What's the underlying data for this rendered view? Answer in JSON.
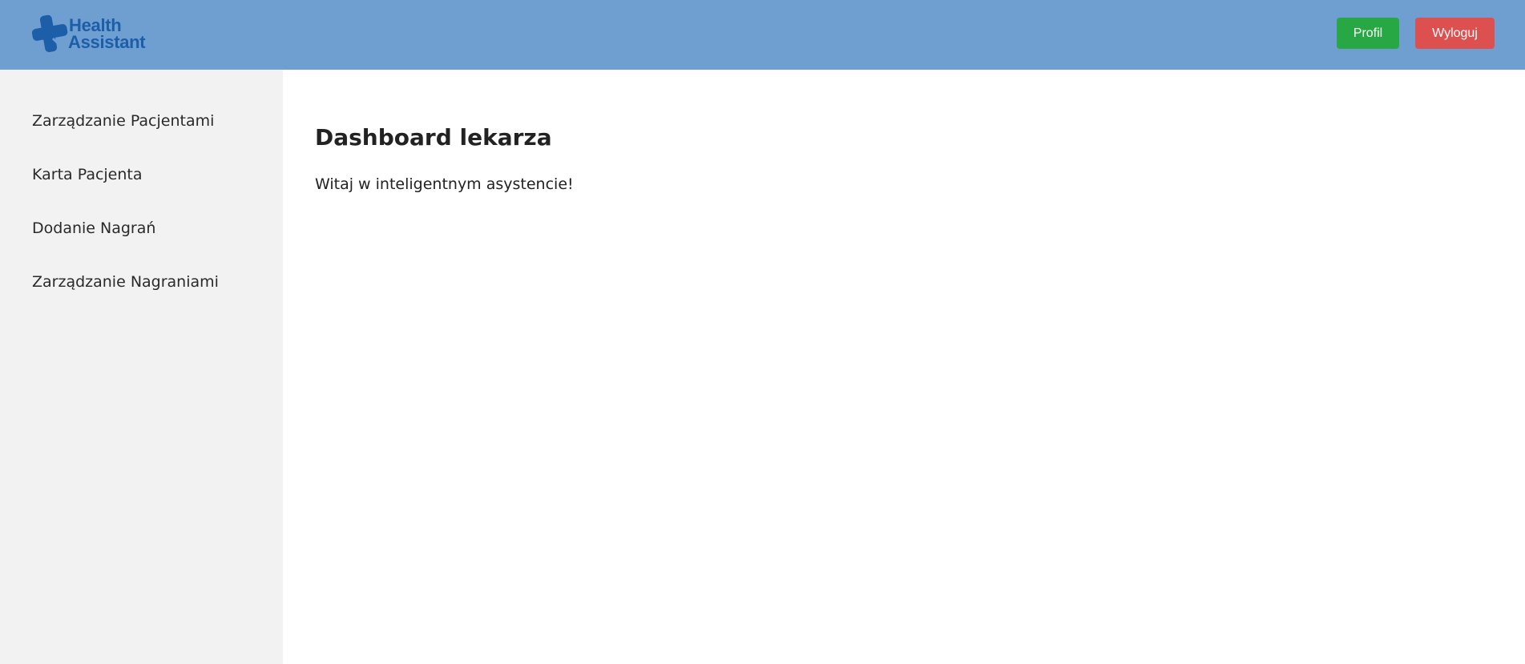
{
  "header": {
    "logo": {
      "line1": "Health",
      "line2": "Assistant",
      "icon": "medical-cross-icon",
      "color": "#1d5ea8"
    },
    "profile_label": "Profil",
    "logout_label": "Wyloguj",
    "background": "#6e9fd0",
    "profile_color": "#28a745",
    "logout_color": "#dc5050"
  },
  "sidebar": {
    "items": [
      {
        "label": "Zarządzanie Pacjentami"
      },
      {
        "label": "Karta Pacjenta"
      },
      {
        "label": "Dodanie Nagrań"
      },
      {
        "label": "Zarządzanie Nagraniami"
      }
    ]
  },
  "main": {
    "title": "Dashboard lekarza",
    "welcome": "Witaj w inteligentnym asystencie!"
  }
}
